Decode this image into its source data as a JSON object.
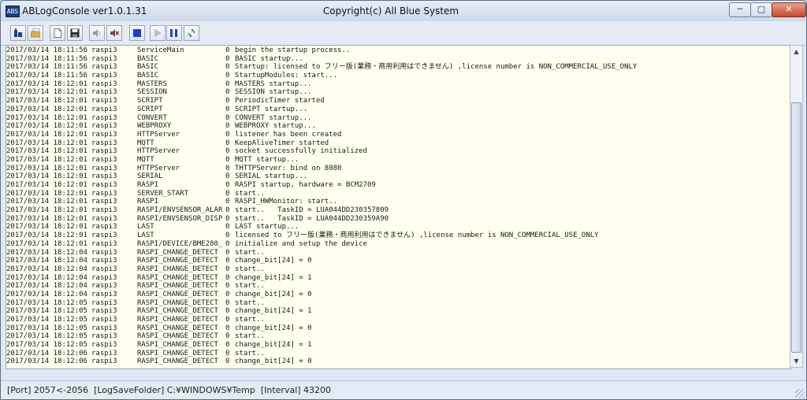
{
  "window": {
    "title": "ABLogConsole ver1.0.1.31",
    "copyright": "Copyright(c) All Blue System",
    "icon_label": "ABS",
    "minimize_glyph": "─",
    "maximize_glyph": "▢",
    "close_glyph": "✕"
  },
  "toolbar": {
    "buttons": [
      {
        "name": "connect-button",
        "icon": "connect-icon"
      },
      {
        "name": "log-folder-button",
        "icon": "folder-log-icon"
      },
      {
        "name": "new-button",
        "icon": "new-document-icon"
      },
      {
        "name": "save-button",
        "icon": "save-icon"
      },
      {
        "name": "sound-off-button",
        "icon": "speaker-off-icon"
      },
      {
        "name": "sound-mute-button",
        "icon": "speaker-mute-icon"
      },
      {
        "name": "stop-button",
        "icon": "stop-icon"
      },
      {
        "name": "play-button",
        "icon": "play-icon"
      },
      {
        "name": "pause-button",
        "icon": "pause-icon"
      },
      {
        "name": "refresh-button",
        "icon": "refresh-icon"
      }
    ]
  },
  "log": {
    "lines": [
      [
        "2017/03/14 18:11:56",
        "raspi3",
        "ServiceMain",
        "0",
        "begin the startup process.."
      ],
      [
        "2017/03/14 18:11:56",
        "raspi3",
        "BASIC",
        "0",
        "BASIC startup..."
      ],
      [
        "2017/03/14 18:11:56",
        "raspi3",
        "BASIC",
        "0",
        "Startup: licensed to フリー版(業務・商用利用はできません) ,license number is NON_COMMERCIAL_USE_ONLY"
      ],
      [
        "2017/03/14 18:11:56",
        "raspi3",
        "BASIC",
        "0",
        "StartupModules: start..."
      ],
      [
        "2017/03/14 18:12:01",
        "raspi3",
        "MASTERS",
        "0",
        "MASTERS startup..."
      ],
      [
        "2017/03/14 18:12:01",
        "raspi3",
        "SESSION",
        "0",
        "SESSION startup..."
      ],
      [
        "2017/03/14 18:12:01",
        "raspi3",
        "SCRIPT",
        "0",
        "PeriodicTimer started"
      ],
      [
        "2017/03/14 18:12:01",
        "raspi3",
        "SCRIPT",
        "0",
        "SCRIPT startup..."
      ],
      [
        "2017/03/14 18:12:01",
        "raspi3",
        "CONVERT",
        "0",
        "CONVERT startup..."
      ],
      [
        "2017/03/14 18:12:01",
        "raspi3",
        "WEBPROXY",
        "0",
        "WEBPROXY startup..."
      ],
      [
        "2017/03/14 18:12:01",
        "raspi3",
        "HTTPServer",
        "0",
        "listener has been created"
      ],
      [
        "2017/03/14 18:12:01",
        "raspi3",
        "MQTT",
        "0",
        "KeepAliveTimer started"
      ],
      [
        "2017/03/14 18:12:01",
        "raspi3",
        "HTTPServer",
        "0",
        "socket successfully initialized"
      ],
      [
        "2017/03/14 18:12:01",
        "raspi3",
        "MQTT",
        "0",
        "MQTT startup..."
      ],
      [
        "2017/03/14 18:12:01",
        "raspi3",
        "HTTPServer",
        "0",
        "THTTPServer: bind on 8080"
      ],
      [
        "2017/03/14 18:12:01",
        "raspi3",
        "SERIAL",
        "0",
        "SERIAL startup..."
      ],
      [
        "2017/03/14 18:12:01",
        "raspi3",
        "RASPI",
        "0",
        "RASPI startup, hardware = BCM2709"
      ],
      [
        "2017/03/14 18:12:01",
        "raspi3",
        "SERVER_START",
        "0",
        "start.."
      ],
      [
        "2017/03/14 18:12:01",
        "raspi3",
        "RASPI",
        "0",
        "RASPI_HWMonitor: start.."
      ],
      [
        "2017/03/14 18:12:01",
        "raspi3",
        "RASPI/ENVSENSOR_ALAR",
        "0",
        "start..   TaskID = LUA044DD230357809"
      ],
      [
        "2017/03/14 18:12:01",
        "raspi3",
        "RASPI/ENVSENSOR_DISP",
        "0",
        "start..   TaskID = LUA044DD230359A90"
      ],
      [
        "2017/03/14 18:12:01",
        "raspi3",
        "LAST",
        "0",
        "LAST startup..."
      ],
      [
        "2017/03/14 18:12:01",
        "raspi3",
        "LAST",
        "0",
        "licensed to フリー版(業務・商用利用はできません) ,license number is NON_COMMERCIAL_USE_ONLY"
      ],
      [
        "2017/03/14 18:12:01",
        "raspi3",
        "RASPI/DEVICE/BME280_",
        "0",
        "initialize and setup the device"
      ],
      [
        "2017/03/14 18:12:04",
        "raspi3",
        "RASPI_CHANGE_DETECT",
        "0",
        "start.."
      ],
      [
        "2017/03/14 18:12:04",
        "raspi3",
        "RASPI_CHANGE_DETECT",
        "0",
        "change_bit[24] = 0"
      ],
      [
        "2017/03/14 18:12:04",
        "raspi3",
        "RASPI_CHANGE_DETECT",
        "0",
        "start.."
      ],
      [
        "2017/03/14 18:12:04",
        "raspi3",
        "RASPI_CHANGE_DETECT",
        "0",
        "change_bit[24] = 1"
      ],
      [
        "2017/03/14 18:12:04",
        "raspi3",
        "RASPI_CHANGE_DETECT",
        "0",
        "start.."
      ],
      [
        "2017/03/14 18:12:04",
        "raspi3",
        "RASPI_CHANGE_DETECT",
        "0",
        "change_bit[24] = 0"
      ],
      [
        "2017/03/14 18:12:05",
        "raspi3",
        "RASPI_CHANGE_DETECT",
        "0",
        "start.."
      ],
      [
        "2017/03/14 18:12:05",
        "raspi3",
        "RASPI_CHANGE_DETECT",
        "0",
        "change_bit[24] = 1"
      ],
      [
        "2017/03/14 18:12:05",
        "raspi3",
        "RASPI_CHANGE_DETECT",
        "0",
        "start.."
      ],
      [
        "2017/03/14 18:12:05",
        "raspi3",
        "RASPI_CHANGE_DETECT",
        "0",
        "change_bit[24] = 0"
      ],
      [
        "2017/03/14 18:12:05",
        "raspi3",
        "RASPI_CHANGE_DETECT",
        "0",
        "start.."
      ],
      [
        "2017/03/14 18:12:05",
        "raspi3",
        "RASPI_CHANGE_DETECT",
        "0",
        "change_bit[24] = 1"
      ],
      [
        "2017/03/14 18:12:06",
        "raspi3",
        "RASPI_CHANGE_DETECT",
        "0",
        "start.."
      ],
      [
        "2017/03/14 18:12:06",
        "raspi3",
        "RASPI_CHANGE_DETECT",
        "0",
        "change_bit[24] = 0"
      ]
    ]
  },
  "scrollbar": {
    "position": 0.95,
    "visible_fraction": 0.84
  },
  "status": {
    "port": "[Port] 2057<-2056",
    "folder": "[LogSaveFolder] C:¥WINDOWS¥Temp",
    "interval": "[Interval] 43200"
  },
  "colors": {
    "log_background": "#fffff0",
    "stop_icon": "#1a3fd6",
    "pause_icon": "#1a3fd6",
    "refresh_icon": "#1b8a2a",
    "mute_icon": "#c21818"
  }
}
